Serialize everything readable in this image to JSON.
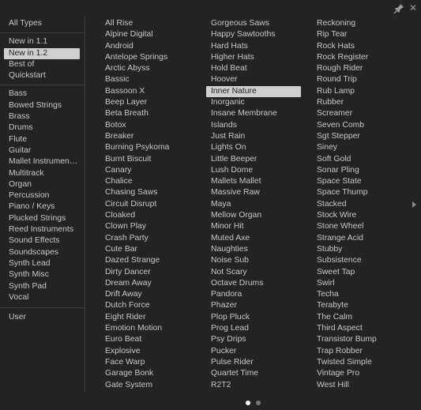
{
  "window": {
    "pin_icon": "pin-icon",
    "close_icon": "close-icon",
    "close_glyph": "✕"
  },
  "sidebar": {
    "groups": [
      {
        "items": [
          {
            "label": "All Types",
            "selected": false
          }
        ]
      },
      {
        "items": [
          {
            "label": "New in 1.1",
            "selected": false
          },
          {
            "label": "New in 1.2",
            "selected": true
          },
          {
            "label": "Best of",
            "selected": false
          },
          {
            "label": "Quickstart",
            "selected": false
          }
        ]
      },
      {
        "items": [
          {
            "label": "Bass",
            "selected": false
          },
          {
            "label": "Bowed Strings",
            "selected": false
          },
          {
            "label": "Brass",
            "selected": false
          },
          {
            "label": "Drums",
            "selected": false
          },
          {
            "label": "Flute",
            "selected": false
          },
          {
            "label": "Guitar",
            "selected": false
          },
          {
            "label": "Mallet Instrumen…",
            "selected": false
          },
          {
            "label": "Multitrack",
            "selected": false
          },
          {
            "label": "Organ",
            "selected": false
          },
          {
            "label": "Percussion",
            "selected": false
          },
          {
            "label": "Piano / Keys",
            "selected": false
          },
          {
            "label": "Plucked Strings",
            "selected": false
          },
          {
            "label": "Reed Instruments",
            "selected": false
          },
          {
            "label": "Sound Effects",
            "selected": false
          },
          {
            "label": "Soundscapes",
            "selected": false
          },
          {
            "label": "Synth Lead",
            "selected": false
          },
          {
            "label": "Synth Misc",
            "selected": false
          },
          {
            "label": "Synth Pad",
            "selected": false
          },
          {
            "label": "Vocal",
            "selected": false
          }
        ]
      },
      {
        "items": [
          {
            "label": "User",
            "selected": false
          }
        ]
      }
    ]
  },
  "presets": {
    "selected": "Inner Nature",
    "columns": [
      [
        "All Rise",
        "Alpine Digital",
        "Android",
        "Antelope Springs",
        "Arctic Abyss",
        "Bassic",
        "Bassoon X",
        "Beep Layer",
        "Beta Breath",
        "Botox",
        "Breaker",
        "Burning Psykoma",
        "Burnt Biscuit",
        "Canary",
        "Chalice",
        "Chasing Saws",
        "Circuit Disrupt",
        "Cloaked",
        "Clown Play",
        "Crash Party",
        "Cute Bar",
        "Dazed Strange",
        "Dirty Dancer",
        "Dream Away",
        "Drift Away",
        "Dutch Force",
        "Eight Rider",
        "Emotion Motion",
        "Euro Beat",
        "Explosive",
        "Face Warp",
        "Garage Bonk",
        "Gate System"
      ],
      [
        "Gorgeous Saws",
        "Happy Sawtooths",
        "Hard Hats",
        "Higher Hats",
        "Hold Beat",
        "Hoover",
        "Inner Nature",
        "Inorganic",
        "Insane Membrane",
        "Islands",
        "Just Rain",
        "Lights On",
        "Little Beeper",
        "Lush Dome",
        "Mallets Mallet",
        "Massive Raw",
        "Maya",
        "Mellow Organ",
        "Minor Hit",
        "Muted Axe",
        "Naughties",
        "Noise Sub",
        "Not Scary",
        "Octave Drums",
        "Pandora",
        "Phazer",
        "Plop Pluck",
        "Prog Lead",
        "Psy Drips",
        "Pucker",
        "Pulse Rider",
        "Quartet Time",
        "R2T2"
      ],
      [
        "Reckoning",
        "Rip Tear",
        "Rock Hats",
        "Rock Register",
        "Rough Rider",
        "Round Trip",
        "Rub Lamp",
        "Rubber",
        "Screamer",
        "Seven Comb",
        "Sgt Stepper",
        "Siney",
        "Soft Gold",
        "Sonar Pling",
        "Space State",
        "Space Thump",
        "Stacked",
        "Stock Wire",
        "Stone Wheel",
        "Strange Acid",
        "Stubby",
        "Subsistence",
        "Sweet Tap",
        "Swirl",
        "Techa",
        "Terabyte",
        "The Calm",
        "Third Aspect",
        "Transistor Bump",
        "Trap Robber",
        "Twisted Simple",
        "Vintage Pro",
        "West Hill"
      ]
    ]
  },
  "pagination": {
    "current_page": 1,
    "total_pages": 2
  },
  "next_page_icon": "chevron-right-icon"
}
